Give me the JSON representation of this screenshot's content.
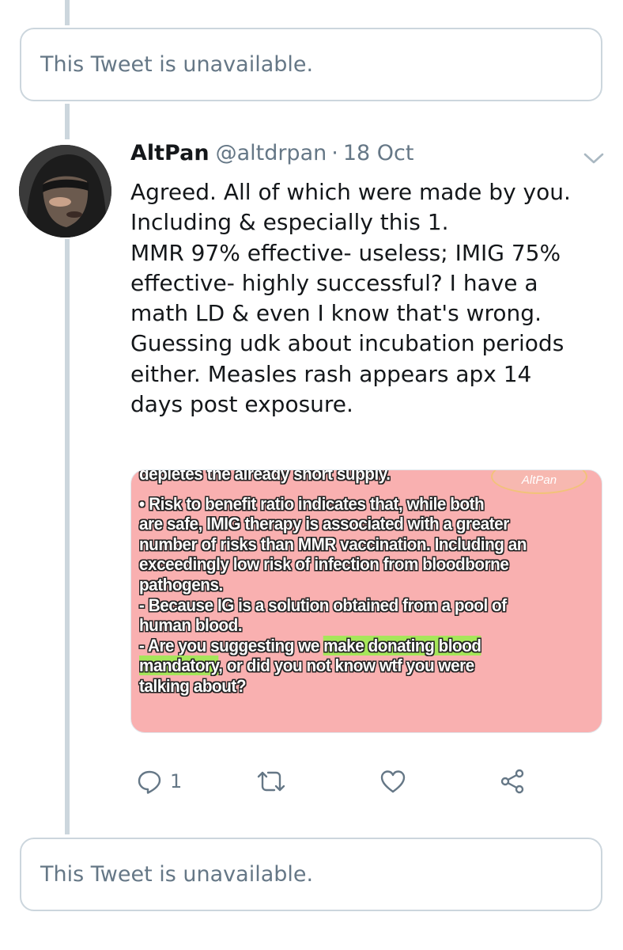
{
  "thread": {
    "unavailable_top": "This Tweet is unavailable.",
    "unavailable_bottom": "This Tweet is unavailable."
  },
  "tweet": {
    "display_name": "AltPan",
    "handle": "@altdrpan",
    "separator": "·",
    "date": "18 Oct",
    "text_lines": [
      "Agreed. All of which were made by you.",
      "Including & especially this 1.",
      "MMR 97% effective- useless; IMIG 75%",
      "effective- highly successful? I have a",
      "math LD & even I know that's wrong.",
      "Guessing udk about incubation periods",
      "either. Measles rash appears apx 14",
      "days post exposure."
    ],
    "media": {
      "logo_text": "AltPan",
      "line_0": "depletes the already short supply.",
      "line_1": "• Risk to benefit ratio indicates  that, while both",
      "line_2": "are safe, IMIG therapy is associated with a greater",
      "line_3": "number of risks than MMR vaccination. Including an",
      "line_4": "exceedingly low risk of infection from bloodborne",
      "line_5": "pathogens.",
      "line_6": "- Because IG is a solution obtained from a pool of",
      "line_7": "human blood.",
      "line_8a": "- Are you suggesting we ",
      "line_8b": "make donating blood",
      "line_9a": "mandatory",
      "line_9b": ", or did you not know wtf you were",
      "line_10": "talking about?",
      "highlight_color": "#a6e65a",
      "background_color": "#f9b0b0"
    },
    "actions": {
      "reply_icon": "reply-icon",
      "reply_count": "1",
      "retweet_icon": "retweet-icon",
      "like_icon": "heart-icon",
      "share_icon": "share-icon"
    }
  },
  "colors": {
    "thread_line": "#ccd6dd",
    "secondary_text": "#657786",
    "primary_text": "#14171a"
  }
}
